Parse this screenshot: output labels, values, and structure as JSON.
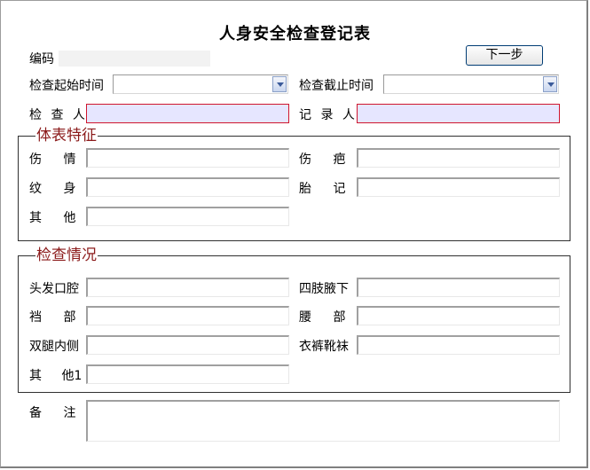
{
  "form": {
    "title": "人身安全检查登记表",
    "code_label": "编码",
    "code_value": "",
    "next_button": "下一步",
    "start_time_label": "检查起始时间",
    "start_time_value": "",
    "end_time_label": "检查截止时间",
    "end_time_value": "",
    "inspector_label": "检 查 人",
    "inspector_value": "",
    "recorder_label": "记 录 人",
    "recorder_value": ""
  },
  "body_features": {
    "legend": "体表特征",
    "injury_label": "伤 情",
    "injury_value": "",
    "scar_label": "伤 疤",
    "scar_value": "",
    "tattoo_label": "纹 身",
    "tattoo_value": "",
    "birthmark_label": "胎 记",
    "birthmark_value": "",
    "other_label": "其 他",
    "other_value": ""
  },
  "inspection": {
    "legend": "检查情况",
    "hair_mouth_label": "头发口腔",
    "hair_mouth_value": "",
    "limbs_armpit_label": "四肢腋下",
    "limbs_armpit_value": "",
    "crotch_label": "裆 部",
    "crotch_value": "",
    "waist_label": "腰 部",
    "waist_value": "",
    "inner_thigh_label": "双腿内侧",
    "inner_thigh_value": "",
    "clothing_label": "衣裤靴袜",
    "clothing_value": "",
    "other1_label": "其 他1",
    "other1_value": ""
  },
  "remarks": {
    "label": "备 注",
    "value": ""
  },
  "colors": {
    "required_border": "#d0162e",
    "required_fill": "#e6e6ff",
    "legend_text": "#8b1a1a"
  }
}
